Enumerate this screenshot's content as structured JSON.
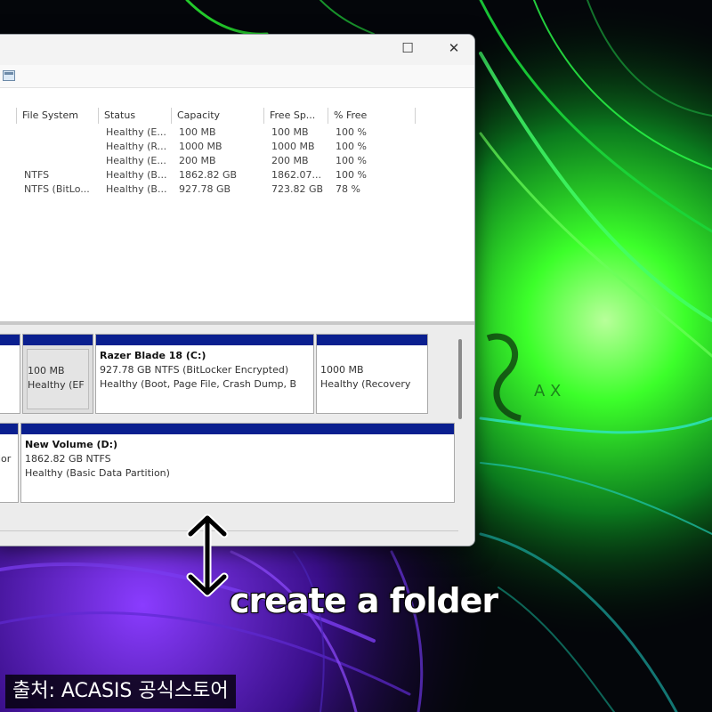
{
  "window": {
    "maximize_glyph": "☐",
    "close_glyph": "✕",
    "toolbar_icon": "disk-properties-icon"
  },
  "volume_list": {
    "columns": [
      "File System",
      "Status",
      "Capacity",
      "Free Sp...",
      "% Free"
    ],
    "rows": [
      {
        "fs": "",
        "status": "Healthy (E...",
        "capacity": "100 MB",
        "free": "100 MB",
        "pct": "100 %"
      },
      {
        "fs": "",
        "status": "Healthy (R...",
        "capacity": "1000 MB",
        "free": "1000 MB",
        "pct": "100 %"
      },
      {
        "fs": "",
        "status": "Healthy (E...",
        "capacity": "200 MB",
        "free": "200 MB",
        "pct": "100 %"
      },
      {
        "fs": "NTFS",
        "status": "Healthy (B...",
        "capacity": "1862.82 GB",
        "free": "1862.07...",
        "pct": "100 %"
      },
      {
        "fs": "NTFS (BitLo...",
        "status": "Healthy (B...",
        "capacity": "927.78 GB",
        "free": "723.82 GB",
        "pct": "78 %"
      }
    ]
  },
  "disk_map": {
    "disk0": {
      "efi": {
        "size": "100 MB",
        "status": "Healthy (EF"
      },
      "c": {
        "name": "Razer Blade 18  (C:)",
        "size": "927.78 GB NTFS (BitLocker Encrypted)",
        "status": "Healthy (Boot, Page File, Crash Dump, B"
      },
      "recovery": {
        "size": "1000 MB",
        "status": "Healthy (Recovery"
      }
    },
    "disk1": {
      "left_label": "ior",
      "d": {
        "name": "New Volume  (D:)",
        "size": "1862.82 GB NTFS",
        "status": "Healthy (Basic Data Partition)"
      }
    }
  },
  "overlay": {
    "caption": "create a folder",
    "source": "출처: ACASIS 공식스토어"
  },
  "colors": {
    "partition_header": "#0a1f8f",
    "wallpaper_green": "#39ff14",
    "wallpaper_purple": "#6a1fd8"
  }
}
